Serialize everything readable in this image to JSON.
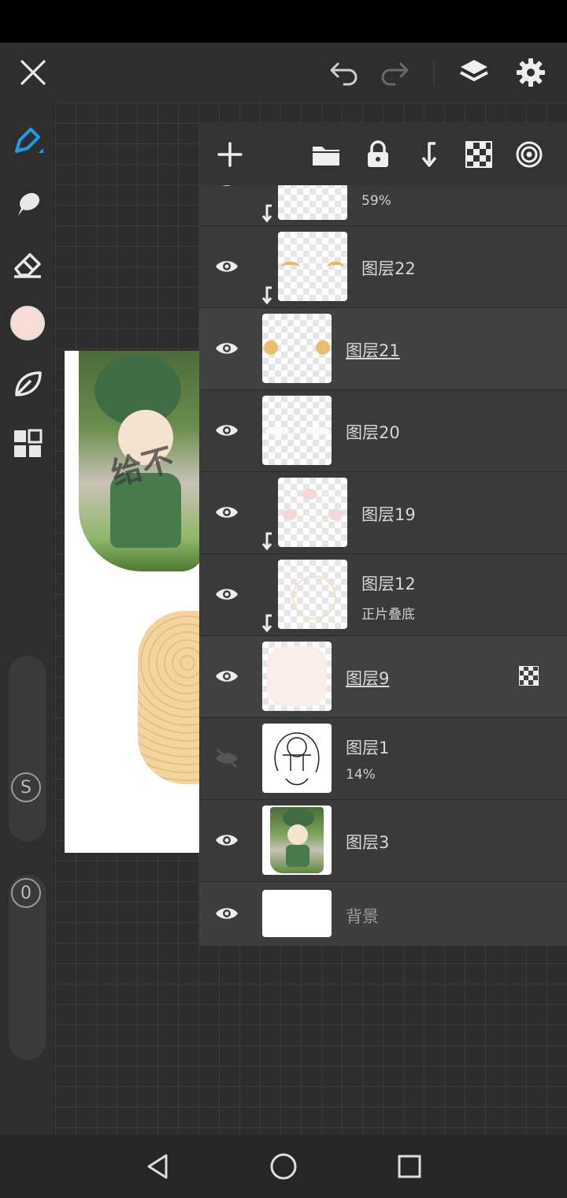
{
  "topbar": {
    "close_icon": "close-icon",
    "undo_icon": "undo-icon",
    "redo_icon": "redo-icon",
    "layers_icon": "layers-icon",
    "settings_icon": "gear-icon"
  },
  "tools": {
    "brush": "pen-icon",
    "smudge": "smudge-icon",
    "eraser": "eraser-icon",
    "color_swatch": "#f8dcd6",
    "blend": "leaf-icon",
    "grid": "grid-icon",
    "size_slider_label": "S",
    "opacity_slider_label": "0"
  },
  "layer_panel": {
    "toolbar": [
      "add-icon",
      "folder-icon",
      "lock-icon",
      "clip-icon",
      "alpha-lock-icon",
      "target-icon"
    ],
    "layers": [
      {
        "name": "",
        "sub": "59%",
        "clipped": true
      },
      {
        "name": "图层22",
        "sub": "",
        "clipped": true
      },
      {
        "name": "图层21",
        "sub": "",
        "clipped": false,
        "underline": true
      },
      {
        "name": "图层20",
        "sub": "",
        "clipped": false
      },
      {
        "name": "图层19",
        "sub": "",
        "clipped": true
      },
      {
        "name": "图层12",
        "sub": "正片叠底",
        "clipped": true
      },
      {
        "name": "图层9",
        "sub": "",
        "clipped": false,
        "underline": true
      },
      {
        "name": "图层1",
        "sub": "14%",
        "clipped": false,
        "hidden": true
      },
      {
        "name": "图层3",
        "sub": "",
        "clipped": false
      },
      {
        "name": "背景",
        "sub": "",
        "clipped": false
      }
    ]
  },
  "artwork": {
    "watermark_text": "给不"
  },
  "colors": {
    "accent": "#1e9be9",
    "panel": "#3a3a3a",
    "toolbar": "#2e2e2e"
  }
}
